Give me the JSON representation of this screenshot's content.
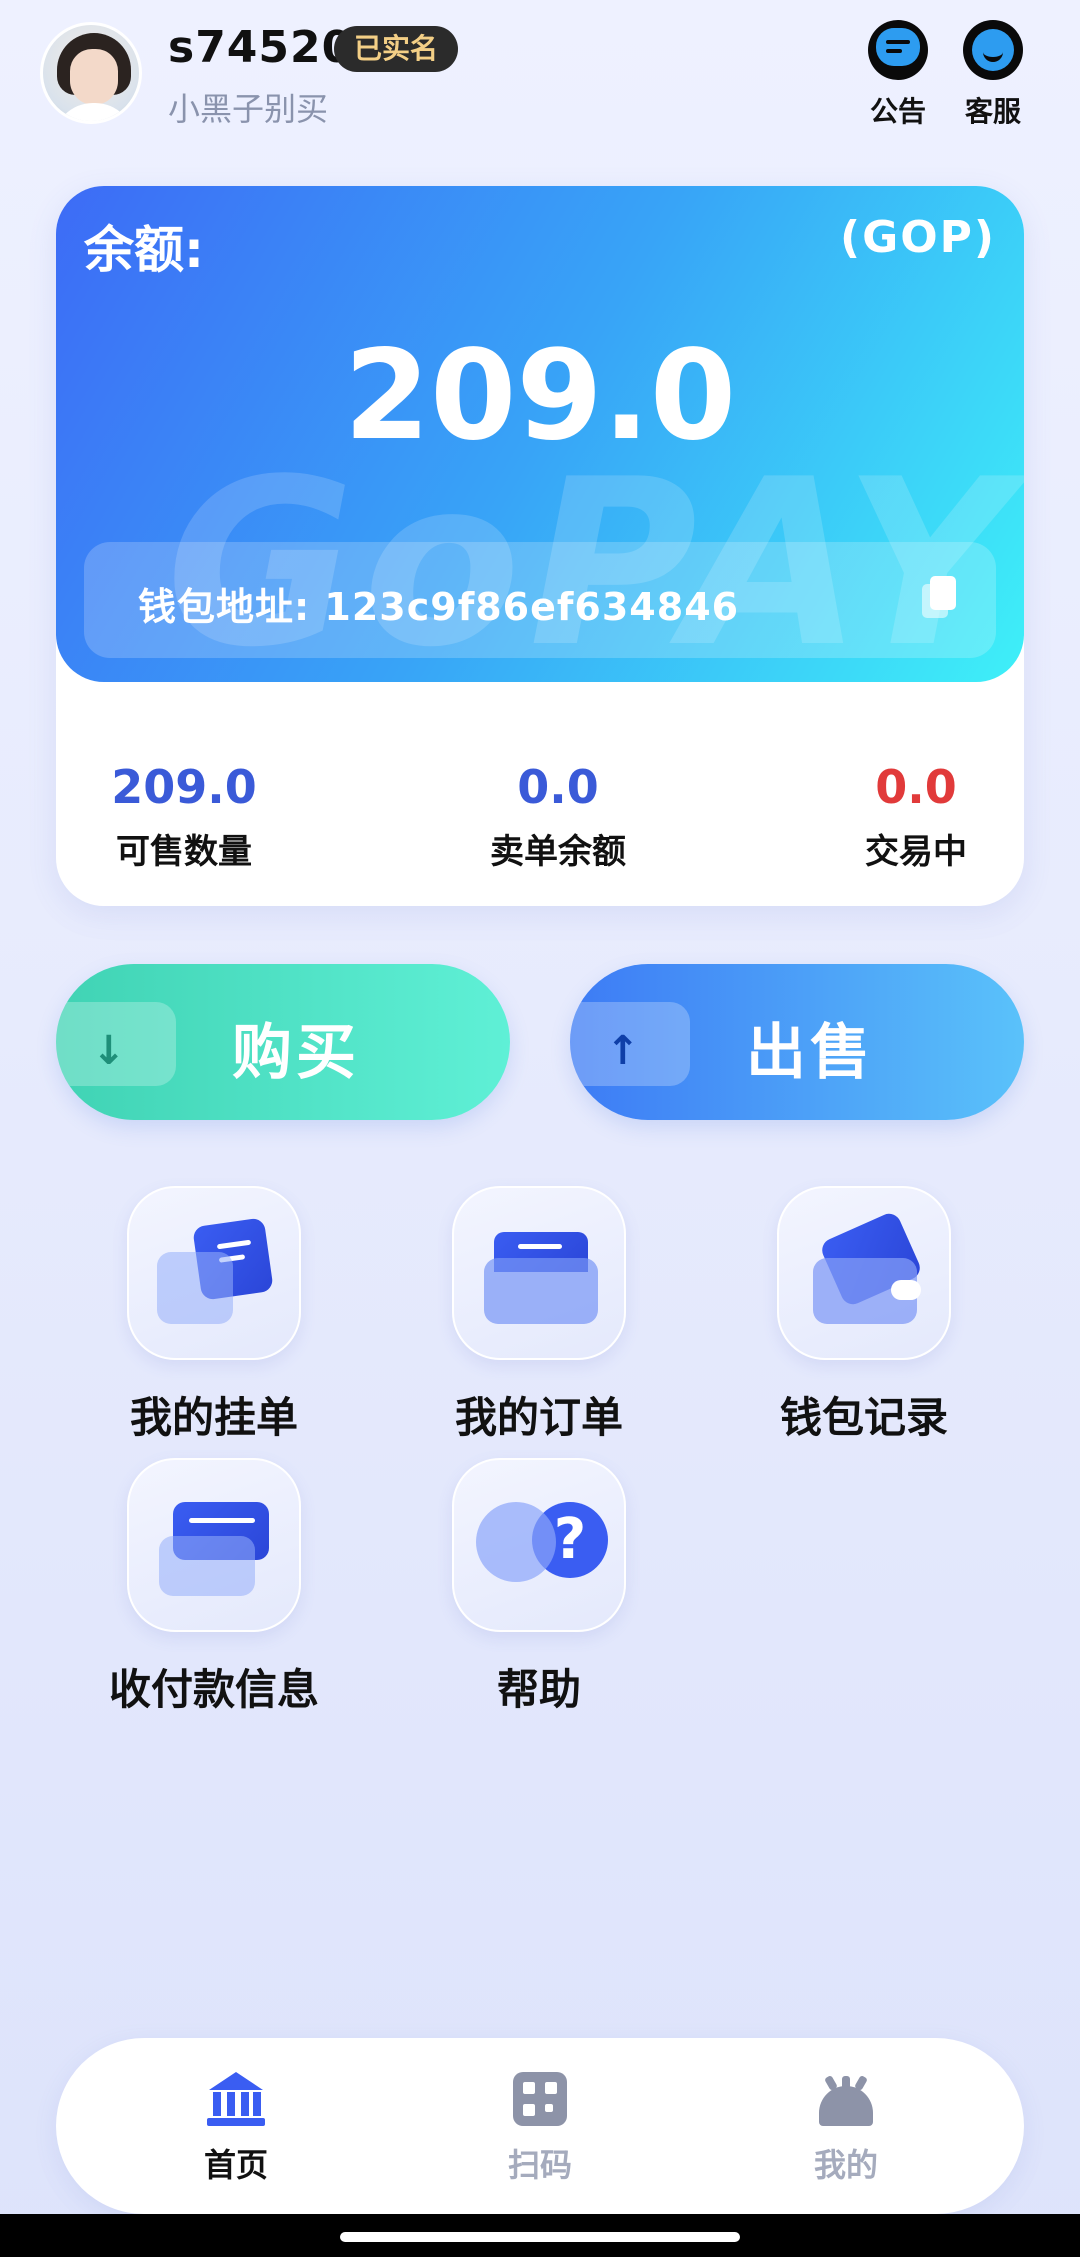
{
  "header": {
    "username": "s74520",
    "verified_badge": "已实名",
    "nickname": "小黑子别买",
    "notice_label": "公告",
    "service_label": "客服"
  },
  "balance_card": {
    "label": "余额:",
    "currency": "(GOP)",
    "amount": "209.0",
    "watermark": "GoPAY",
    "wallet_address": "钱包地址: 123c9f86ef634846"
  },
  "stats": [
    {
      "value": "209.0",
      "label": "可售数量",
      "color": "#3a5ad8"
    },
    {
      "value": "0.0",
      "label": "卖单余额",
      "color": "#3a5ad8"
    },
    {
      "value": "0.0",
      "label": "交易中",
      "color": "#e13a3a"
    }
  ],
  "actions": {
    "buy_label": "购买",
    "sell_label": "出售"
  },
  "menu": [
    {
      "label": "我的挂单",
      "icon": "listing-icon"
    },
    {
      "label": "我的订单",
      "icon": "folder-icon"
    },
    {
      "label": "钱包记录",
      "icon": "wallet-icon"
    },
    {
      "label": "收付款信息",
      "icon": "card-icon"
    },
    {
      "label": "帮助",
      "icon": "help-icon"
    }
  ],
  "tabbar": [
    {
      "label": "首页",
      "icon": "bank-icon",
      "active": true
    },
    {
      "label": "扫码",
      "icon": "qr-scan-icon",
      "active": false
    },
    {
      "label": "我的",
      "icon": "profile-icon",
      "active": false
    }
  ],
  "colors": {
    "accent": "#3a5df2",
    "buy_gradient": "#40d3b4",
    "sell_gradient": "#3d7bf5",
    "negative": "#e13a3a"
  }
}
